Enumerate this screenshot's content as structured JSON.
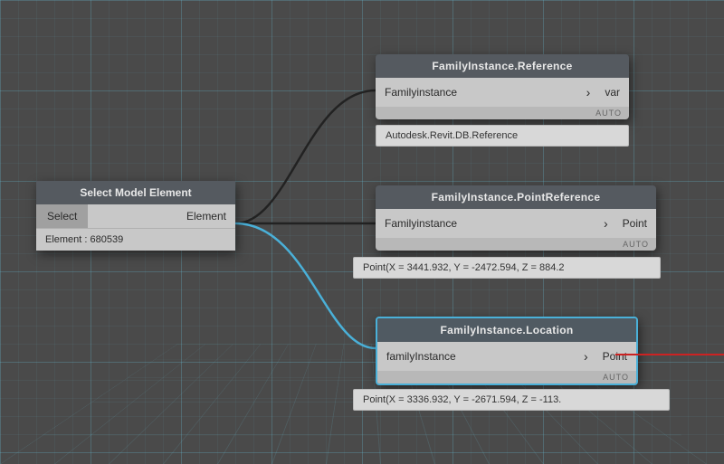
{
  "canvas": {
    "background_color": "#4a4a4a"
  },
  "nodes": {
    "select_model_element": {
      "title": "Select Model Element",
      "select_btn": "Select",
      "element_label": "Element",
      "info": "Element : 680539"
    },
    "family_instance_reference": {
      "title": "FamilyInstance.Reference",
      "input_label": "Familyinstance",
      "output_label": "var",
      "footer": "AUTO",
      "output_value": "Autodesk.Revit.DB.Reference"
    },
    "family_instance_point_reference": {
      "title": "FamilyInstance.PointReference",
      "input_label": "Familyinstance",
      "output_label": "Point",
      "footer": "AUTO",
      "output_value": "Point(X = 3441.932, Y = -2472.594, Z = 884.2"
    },
    "family_instance_location": {
      "title": "FamilyInstance.Location",
      "input_label": "familyInstance",
      "output_label": "Point",
      "footer": "AUTO",
      "output_value": "Point(X = 3336.932, Y = -2671.594, Z = -113."
    }
  }
}
